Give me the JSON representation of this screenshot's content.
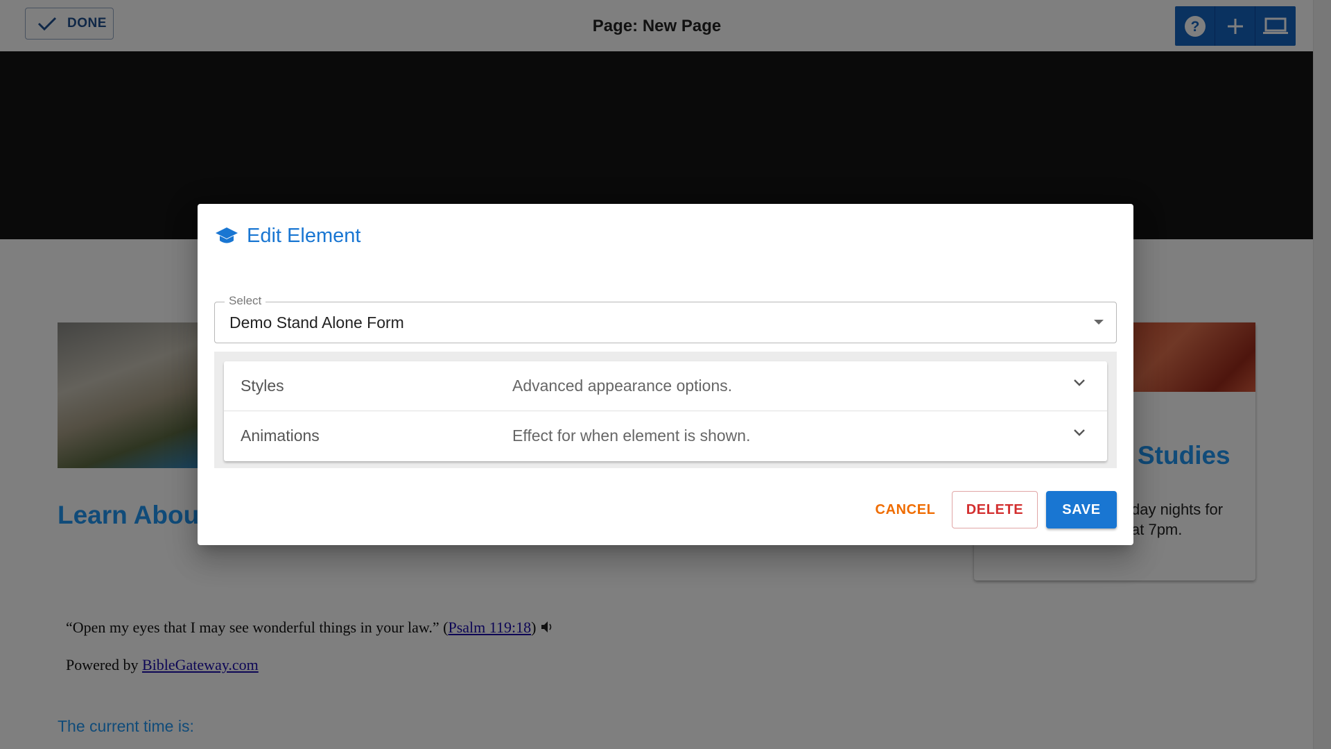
{
  "topbar": {
    "done_label": "DONE",
    "page_title": "Page: New Page",
    "tools": [
      "help-icon",
      "add-icon",
      "laptop-icon"
    ]
  },
  "background": {
    "learn_heading": "Learn About",
    "studies_heading": "Studies",
    "card_text_line1": "day nights for",
    "card_text_line2": "at 7pm.",
    "verse_text": "“Open my eyes that I may see wonderful things in your law.” (",
    "verse_link": "Psalm 119:18",
    "verse_close": ")",
    "powered_prefix": "Powered by ",
    "powered_link": "BibleGateway.com",
    "time_text": "The current time is:"
  },
  "dialog": {
    "icon": "graduation-cap-icon",
    "title": "Edit Element",
    "select_label": "Select",
    "select_value": "Demo Stand Alone Form",
    "panels": [
      {
        "title": "Styles",
        "description": "Advanced appearance options."
      },
      {
        "title": "Animations",
        "description": "Effect for when element is shown."
      }
    ],
    "cancel_label": "CANCEL",
    "delete_label": "DELETE",
    "save_label": "SAVE"
  },
  "colors": {
    "primary": "#1976d2",
    "cancel": "#ef6c00",
    "delete": "#d32f2f"
  }
}
